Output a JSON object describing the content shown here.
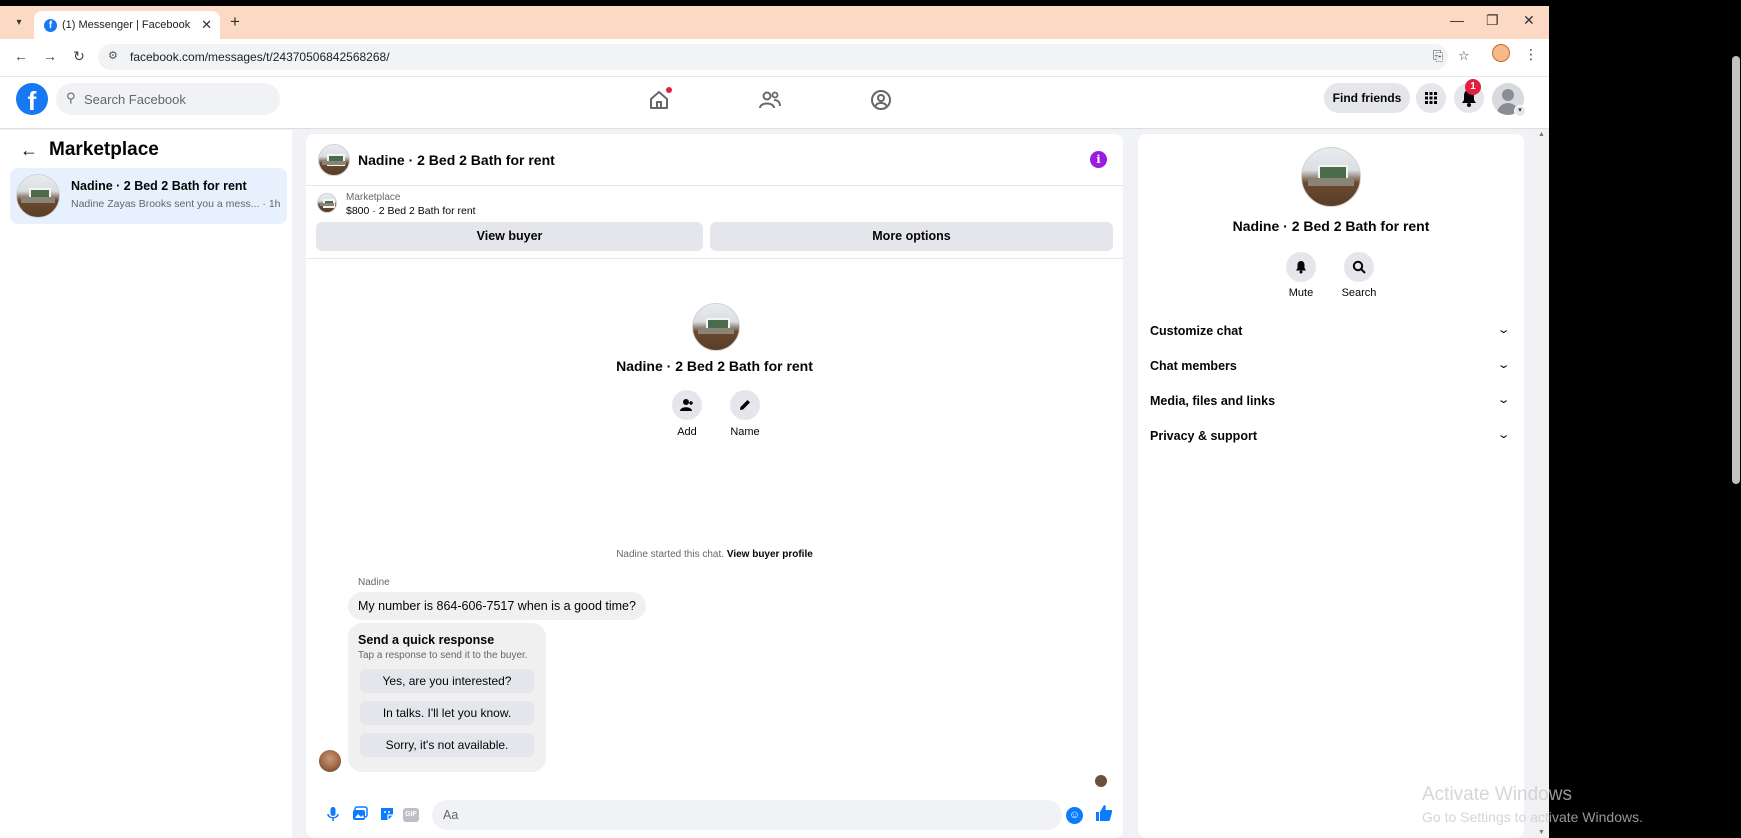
{
  "browser": {
    "tab_title": "(1) Messenger | Facebook",
    "url": "facebook.com/messages/t/24370506842568268/"
  },
  "header": {
    "search_placeholder": "Search Facebook",
    "find_friends": "Find friends",
    "notification_count": "1"
  },
  "sidebar": {
    "title": "Marketplace",
    "conversations": [
      {
        "name": "Nadine · 2 Bed 2 Bath for rent",
        "preview": "Nadine Zayas Brooks sent you a mess... · 1h"
      }
    ]
  },
  "chat": {
    "title": "Nadine · 2 Bed 2 Bath for rent",
    "listing_source": "Marketplace",
    "listing_price": "$800 · 2 Bed 2 Bath for rent",
    "view_buyer": "View buyer",
    "more_options": "More options",
    "intro_title": "Nadine · 2 Bed 2 Bath for rent",
    "add_label": "Add",
    "name_label": "Name",
    "started_text": "Nadine started this chat.",
    "view_buyer_profile": "View buyer profile",
    "sender": "Nadine",
    "message": "My number is 864-606-7517 when is a good time?",
    "quick_title": "Send a quick response",
    "quick_sub": "Tap a response to send it to the buyer.",
    "quick_options": [
      "Yes, are you interested?",
      "In talks. I'll let you know.",
      "Sorry, it's not available."
    ],
    "composer_placeholder": "Aa",
    "gif_label": "GIF"
  },
  "right_panel": {
    "title": "Nadine · 2 Bed 2 Bath for rent",
    "mute": "Mute",
    "search": "Search",
    "sections": [
      "Customize chat",
      "Chat members",
      "Media, files and links",
      "Privacy & support"
    ]
  },
  "watermark": {
    "title": "Activate Windows",
    "subtitle": "Go to Settings to activate Windows."
  },
  "colors": {
    "tabstrip": "#fcd9c5",
    "brand": "#1877f2",
    "messenger_blue": "#0a7cff",
    "info_purple": "#9b1ce0",
    "selected_row": "#e7f0fd"
  }
}
